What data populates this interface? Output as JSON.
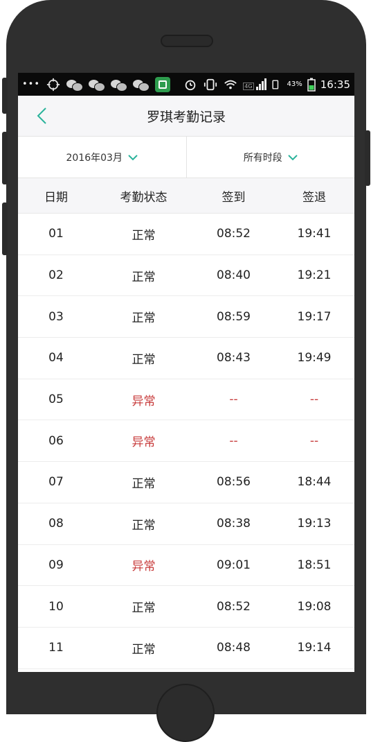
{
  "statusbar": {
    "more": "•••",
    "network": "4G",
    "battery_pct": "43%",
    "time": "16:35"
  },
  "header": {
    "title": "罗琪考勤记录",
    "back_icon": "back-chevron-icon"
  },
  "filters": {
    "month": "2016年03月",
    "period": "所有时段"
  },
  "table": {
    "columns": [
      "日期",
      "考勤状态",
      "签到",
      "签退"
    ],
    "rows": [
      {
        "day": "01",
        "status": "正常",
        "in": "08:52",
        "out": "19:41",
        "abnormal": false
      },
      {
        "day": "02",
        "status": "正常",
        "in": "08:40",
        "out": "19:21",
        "abnormal": false
      },
      {
        "day": "03",
        "status": "正常",
        "in": "08:59",
        "out": "19:17",
        "abnormal": false
      },
      {
        "day": "04",
        "status": "正常",
        "in": "08:43",
        "out": "19:49",
        "abnormal": false
      },
      {
        "day": "05",
        "status": "异常",
        "in": "--",
        "out": "--",
        "abnormal": true
      },
      {
        "day": "06",
        "status": "异常",
        "in": "--",
        "out": "--",
        "abnormal": true
      },
      {
        "day": "07",
        "status": "正常",
        "in": "08:56",
        "out": "18:44",
        "abnormal": false
      },
      {
        "day": "08",
        "status": "正常",
        "in": "08:38",
        "out": "19:13",
        "abnormal": false
      },
      {
        "day": "09",
        "status": "异常",
        "in": "09:01",
        "out": "18:51",
        "abnormal": true
      },
      {
        "day": "10",
        "status": "正常",
        "in": "08:52",
        "out": "19:08",
        "abnormal": false
      },
      {
        "day": "11",
        "status": "正常",
        "in": "08:48",
        "out": "19:14",
        "abnormal": false
      }
    ]
  },
  "colors": {
    "accent": "#2bb39b",
    "abnormal": "#c73a3a",
    "header_bg": "#f6f6f8"
  }
}
